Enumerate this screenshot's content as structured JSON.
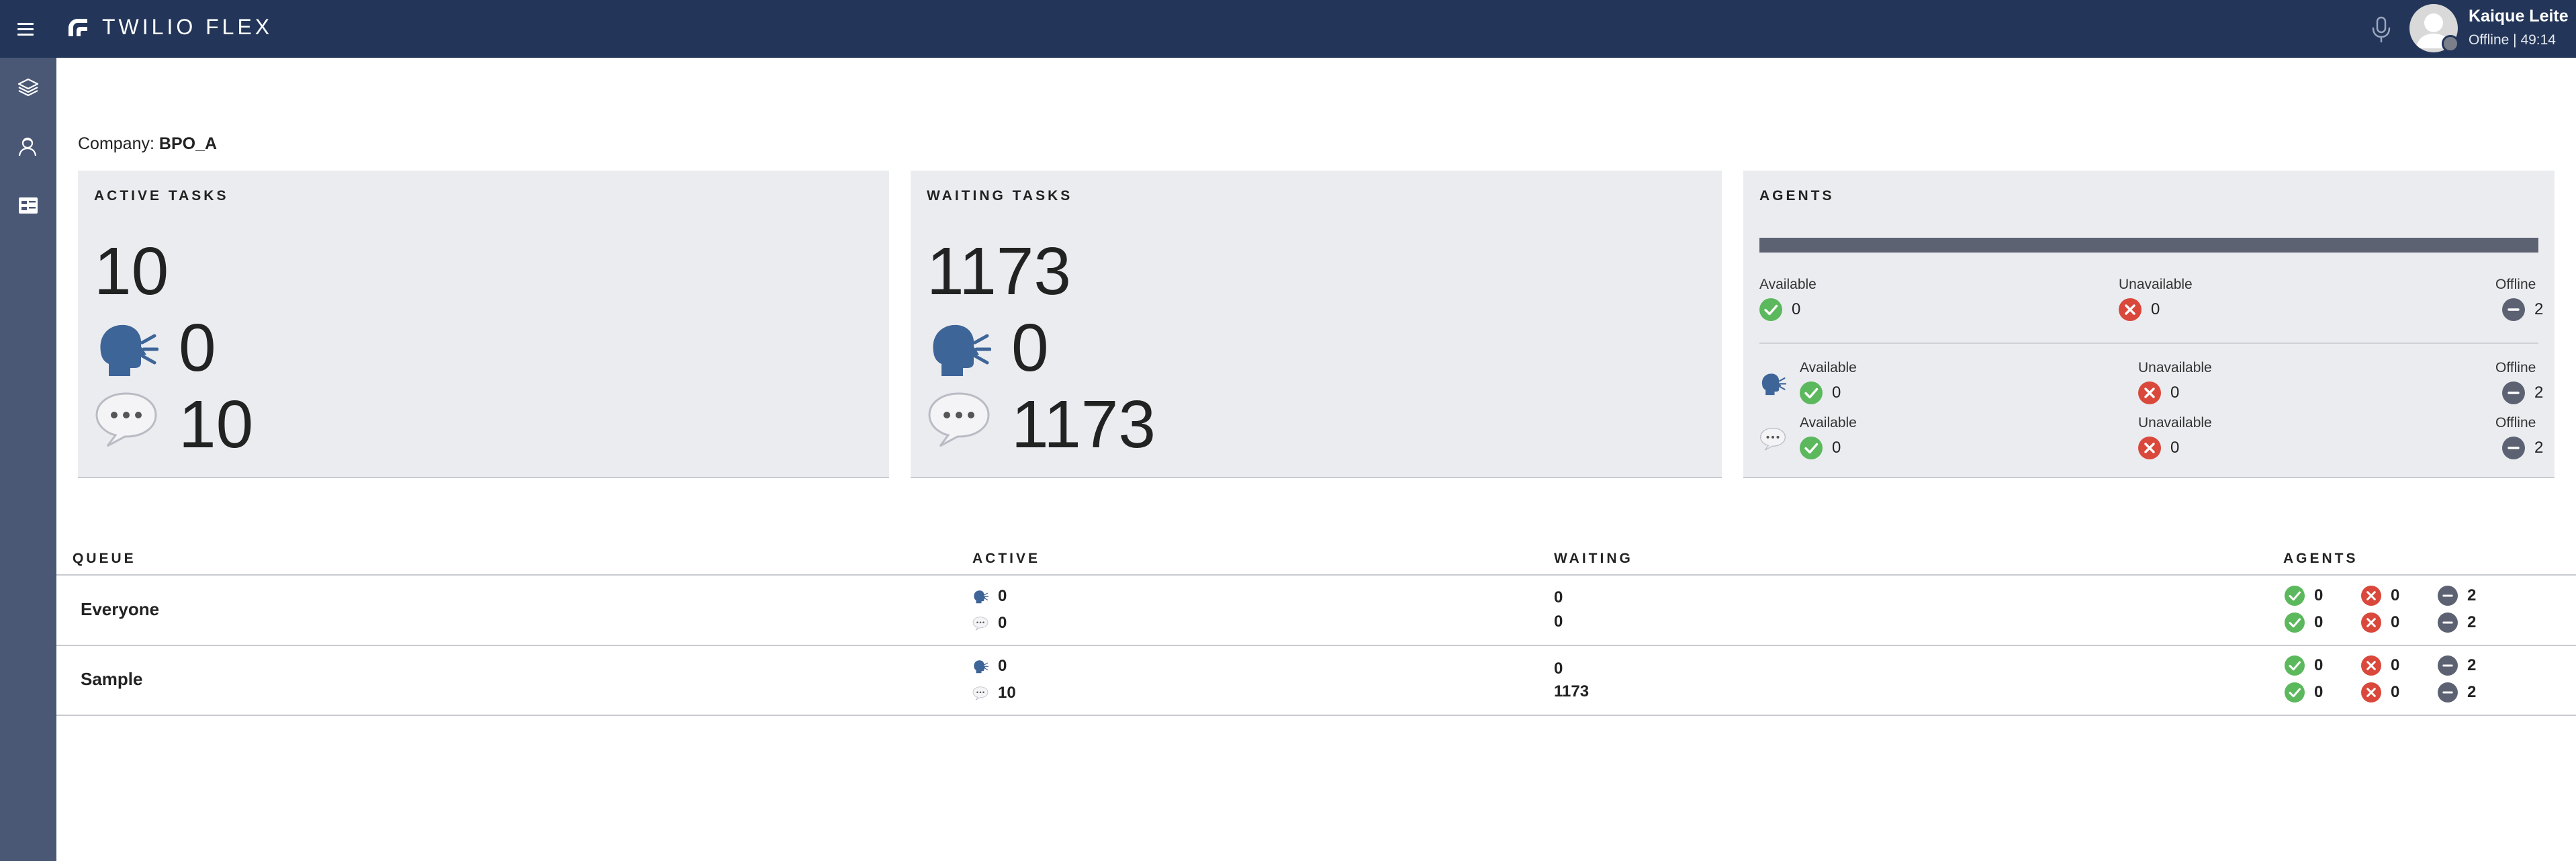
{
  "app": {
    "brand": "TWILIO FLEX",
    "user_name": "Kaique Leite",
    "user_status": "Offline | 49:14"
  },
  "company": {
    "label": "Company:",
    "value": "BPO_A"
  },
  "cards": {
    "active": {
      "title": "ACTIVE TASKS",
      "total": "10",
      "voice": "0",
      "chat": "10"
    },
    "waiting": {
      "title": "WAITING TASKS",
      "total": "1173",
      "voice": "0",
      "chat": "1173"
    },
    "agents": {
      "title": "AGENTS",
      "labels": {
        "available": "Available",
        "unavailable": "Unavailable",
        "offline": "Offline"
      },
      "total": {
        "available": "0",
        "unavailable": "0",
        "offline": "2"
      },
      "voice": {
        "available": "0",
        "unavailable": "0",
        "offline": "2"
      },
      "chat": {
        "available": "0",
        "unavailable": "0",
        "offline": "2"
      }
    }
  },
  "table": {
    "headers": [
      "QUEUE",
      "ACTIVE",
      "WAITING",
      "AGENTS"
    ],
    "rows": [
      {
        "queue": "Everyone",
        "active_voice": "0",
        "active_chat": "0",
        "waiting_voice": "0",
        "waiting_chat": "0",
        "agents_voice": {
          "available": "0",
          "unavailable": "0",
          "offline": "2"
        },
        "agents_chat": {
          "available": "0",
          "unavailable": "0",
          "offline": "2"
        }
      },
      {
        "queue": "Sample",
        "active_voice": "0",
        "active_chat": "10",
        "waiting_voice": "0",
        "waiting_chat": "1173",
        "agents_voice": {
          "available": "0",
          "unavailable": "0",
          "offline": "2"
        },
        "agents_chat": {
          "available": "0",
          "unavailable": "0",
          "offline": "2"
        }
      }
    ]
  },
  "colors": {
    "topbar": "#233659",
    "sidenav": "#4a5775",
    "available": "#5cb85c",
    "unavailable": "#d9483b",
    "offline": "#5c6272",
    "card_bg": "#ebecf0"
  },
  "icons": [
    "menu-icon",
    "flex-logo-icon",
    "microphone-icon",
    "layers-icon",
    "agent-icon",
    "queues-stats-icon",
    "speaking-head-icon",
    "speech-bubble-icon",
    "check-icon",
    "x-icon",
    "minus-icon"
  ]
}
